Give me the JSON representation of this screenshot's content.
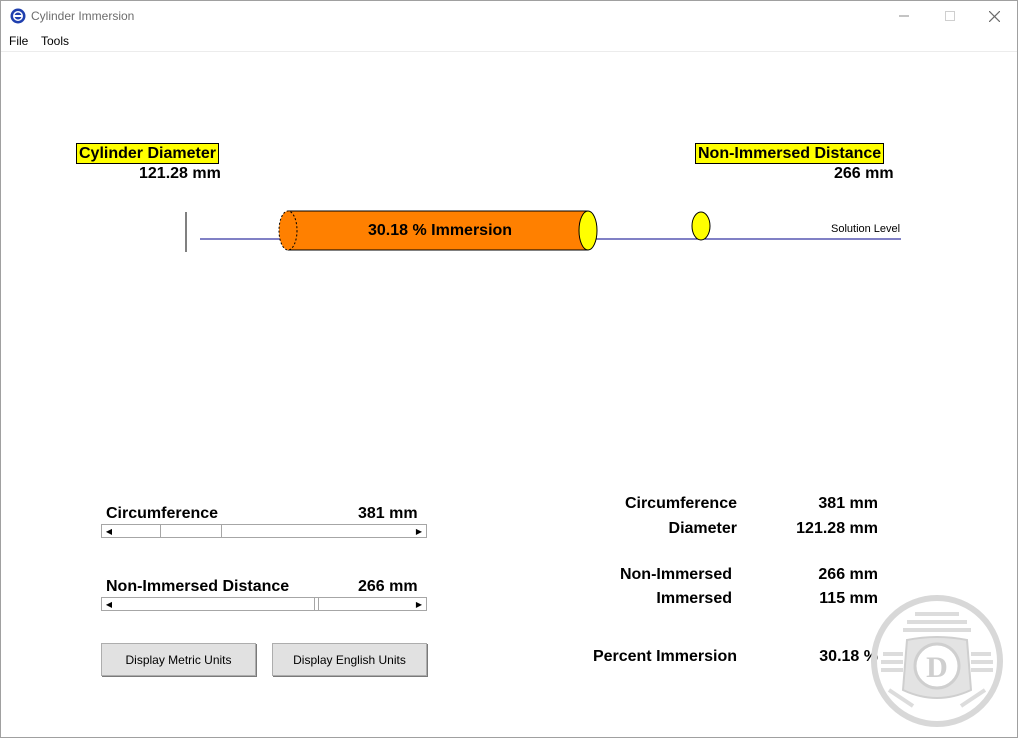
{
  "window": {
    "title": "Cylinder Immersion",
    "minimize_icon": "minimize-icon",
    "maximize_icon": "maximize-icon",
    "close_icon": "close-icon"
  },
  "menu": {
    "items": [
      "File",
      "Tools"
    ]
  },
  "diagram": {
    "cylinder_diameter_label": "Cylinder Diameter",
    "cylinder_diameter_value": "121.28 mm",
    "non_immersed_label": "Non-Immersed Distance",
    "non_immersed_value": "266 mm",
    "cylinder_text": "30.18 % Immersion",
    "solution_level_label": "Solution Level",
    "colors": {
      "cylinder": "#ff8000",
      "cylinder_end": "#ffff00",
      "solution_line": "#00008b",
      "label_bg": "#ffff00"
    }
  },
  "controls": {
    "circumference_label": "Circumference",
    "circumference_value": "381 mm",
    "circumference_slider_fraction": 0.19,
    "non_immersed_label": "Non-Immersed Distance",
    "non_immersed_value": "266 mm",
    "non_immersed_slider_fraction": 0.68,
    "metric_button": "Display Metric Units",
    "english_button": "Display English Units"
  },
  "results": {
    "circumference_label": "Circumference",
    "circumference_value": "381 mm",
    "diameter_label": "Diameter",
    "diameter_value": "121.28 mm",
    "non_immersed_label": "Non-Immersed",
    "non_immersed_value": "266 mm",
    "immersed_label": "Immersed",
    "immersed_value": "115 mm",
    "percent_label": "Percent Immersion",
    "percent_value": "30.18 %"
  },
  "watermark": {
    "letter": "D"
  }
}
